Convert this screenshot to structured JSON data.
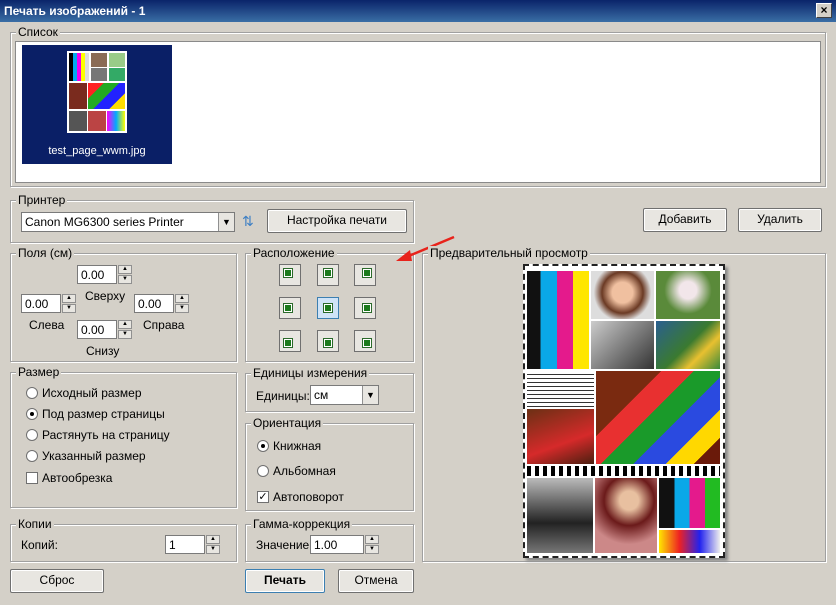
{
  "window": {
    "title": "Печать изображений - 1",
    "close_icon": "close-icon"
  },
  "list": {
    "label": "Список",
    "items": [
      {
        "filename": "test_page_wwm.jpg"
      }
    ]
  },
  "printer": {
    "label": "Принтер",
    "selected": "Canon MG6300 series Printer",
    "settings_button": "Настройка печати",
    "refresh_icon": "refresh-icon"
  },
  "actions": {
    "add": "Добавить",
    "delete": "Удалить"
  },
  "margins": {
    "label": "Поля (см)",
    "top": {
      "label": "Сверху",
      "value": "0.00"
    },
    "left": {
      "label": "Слева",
      "value": "0.00"
    },
    "right": {
      "label": "Справа",
      "value": "0.00"
    },
    "bottom": {
      "label": "Снизу",
      "value": "0.00"
    }
  },
  "placement": {
    "label": "Расположение",
    "selected": "center-center"
  },
  "preview": {
    "label": "Предварительный просмотр"
  },
  "size": {
    "label": "Размер",
    "options": [
      "Исходный размер",
      "Под размер страницы",
      "Растянуть на страницу",
      "Указанный размер"
    ],
    "selected_index": 1,
    "autocrop": {
      "label": "Автообрезка",
      "checked": false
    }
  },
  "units": {
    "label": "Единицы измерения",
    "field_label": "Единицы:",
    "value": "см"
  },
  "orientation": {
    "label": "Ориентация",
    "portrait": "Книжная",
    "landscape": "Альбомная",
    "selected": "portrait",
    "autorotate": {
      "label": "Автоповорот",
      "checked": true
    }
  },
  "copies": {
    "label": "Копии",
    "field_label": "Копий:",
    "value": "1"
  },
  "gamma": {
    "label": "Гамма-коррекция",
    "field_label": "Значение:",
    "value": "1.00"
  },
  "footer": {
    "reset": "Сброс",
    "print": "Печать",
    "cancel": "Отмена"
  },
  "colors": {
    "title_bar": "#0a246a",
    "thumbnail_bg": "#0a1f66",
    "annotation_arrow": "#e8231b"
  }
}
